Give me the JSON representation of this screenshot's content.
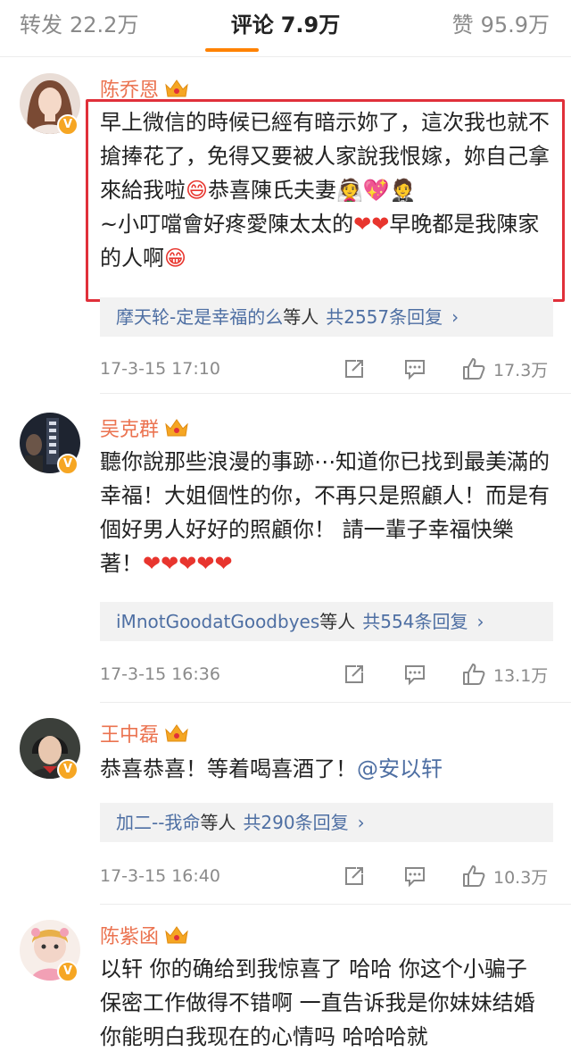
{
  "tabs": {
    "repost": {
      "label": "转发",
      "count": "22.2万"
    },
    "comments": {
      "label": "评论",
      "count": "7.9万"
    },
    "likes": {
      "label": "赞",
      "count": "95.9万"
    }
  },
  "comments": [
    {
      "name": "陈乔恩",
      "text": "早上微信的時候已經有暗示妳了，這次我也就不搶捧花了，免得又要被人家說我恨嫁，妳自己拿來給我啦",
      "text2": "恭喜陳氏夫妻",
      "text3": "~小叮噹會好疼愛陳太太的",
      "text4": "早晚都是我陳家的人啊",
      "emoji_1": "😄",
      "emoji_2": "👰💖🤵",
      "emoji_3": "❤❤",
      "emoji_4": "😁",
      "replies_user": "摩天轮-定是幸福的么",
      "replies_mid": "等人",
      "replies_total": "共2557条回复",
      "time": "17-3-15 17:10",
      "likes": "17.3万"
    },
    {
      "name": "吴克群",
      "text": "聽你說那些浪漫的事跡⋯知道你已找到最美滿的幸福！大姐個性的你，不再只是照顧人！而是有個好男人好好的照顧你！ 請一輩子幸福快樂著！",
      "emoji_1": "❤❤❤❤❤",
      "replies_user": "iMnotGoodatGoodbyes",
      "replies_mid": "等人",
      "replies_total": "共554条回复",
      "time": "17-3-15 16:36",
      "likes": "13.1万"
    },
    {
      "name": "王中磊",
      "text": "恭喜恭喜！等着喝喜酒了！",
      "mention": "@安以轩",
      "replies_user": "加二--我命",
      "replies_mid": "等人",
      "replies_total": "共290条回复",
      "time": "17-3-15 16:40",
      "likes": "10.3万"
    },
    {
      "name": "陈紫函",
      "text": "以轩 你的确给到我惊喜了 哈哈 你这个小骗子 保密工作做得不错啊 一直告诉我是你妹妹结婚 你能明白我现在的心情吗 哈哈哈就"
    }
  ],
  "badge_letter": "V",
  "colors": {
    "accent": "#ff8200",
    "name": "#eb7350",
    "link": "#4e6fa3",
    "highlight_box": "#e0303a",
    "verified_badge": "#f6a623"
  },
  "icons": {
    "share": "share-icon",
    "reply": "comment-icon",
    "like": "thumbs-up-icon",
    "crown": "vip-crown-icon",
    "verified": "verified-badge-icon",
    "chevron": "chevron-right-icon"
  }
}
